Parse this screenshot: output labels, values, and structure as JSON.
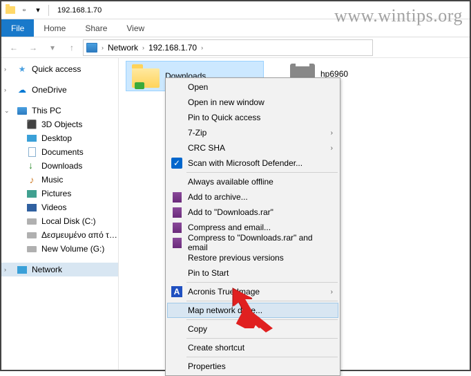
{
  "window": {
    "title": "192.168.1.70"
  },
  "ribbon": {
    "file": "File",
    "home": "Home",
    "share": "Share",
    "view": "View"
  },
  "breadcrumb": {
    "root": "Network",
    "host": "192.168.1.70"
  },
  "sidebar": {
    "quick": "Quick access",
    "onedrive": "OneDrive",
    "thispc": "This PC",
    "objects3d": "3D Objects",
    "desktop": "Desktop",
    "documents": "Documents",
    "downloads": "Downloads",
    "music": "Music",
    "pictures": "Pictures",
    "videos": "Videos",
    "localdisk": "Local Disk (C:)",
    "reserved": "Δεσμευμένο από τ…",
    "newvol": "New Volume (G:)",
    "network": "Network"
  },
  "items": {
    "downloads": "Downloads",
    "printer": "hp6960"
  },
  "ctx": {
    "open": "Open",
    "open_new": "Open in new window",
    "pin_quick": "Pin to Quick access",
    "sevenzip": "7-Zip",
    "crcsha": "CRC SHA",
    "scan": "Scan with Microsoft Defender...",
    "offline": "Always available offline",
    "archive": "Add to archive...",
    "addrar": "Add to \"Downloads.rar\"",
    "compress_email": "Compress and email...",
    "compress_rar_email": "Compress to \"Downloads.rar\" and email",
    "restore": "Restore previous versions",
    "pin_start": "Pin to Start",
    "acronis": "Acronis True Image",
    "map_drive": "Map network drive...",
    "copy": "Copy",
    "shortcut": "Create shortcut",
    "properties": "Properties"
  },
  "watermark": "www.wintips.org"
}
